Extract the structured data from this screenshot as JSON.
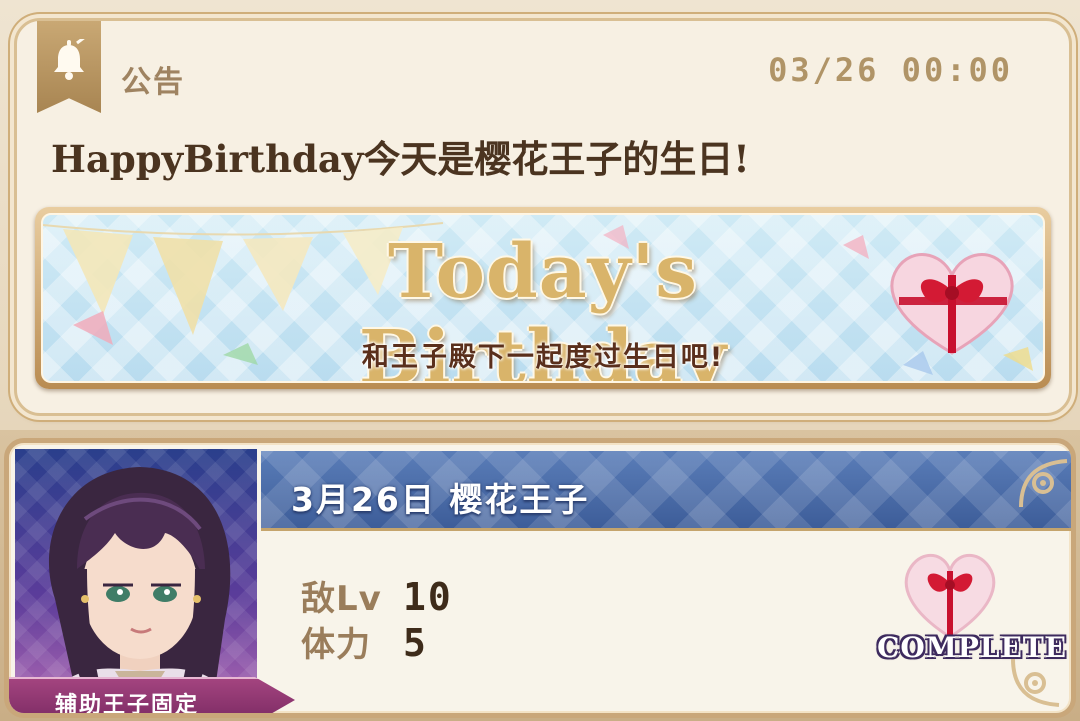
{
  "announcement": {
    "category": "公告",
    "datetime": "03/26 00:00",
    "title": "HappyBirthday今天是樱花王子的生日!",
    "banner": {
      "title": "Today's Birthday",
      "subtitle": "和王子殿下一起度过生日吧!"
    }
  },
  "stage": {
    "title": "3月26日 樱花王子",
    "stats": [
      {
        "label": "敌Lv",
        "value": "10"
      },
      {
        "label": "体力",
        "value": "5"
      }
    ],
    "status": "COMPLETE",
    "support_tag": "辅助王子固定"
  },
  "icons": {
    "bell": "bell-icon",
    "heart_gift": "heart-gift-icon",
    "corner": "ornate-corner-icon"
  },
  "colors": {
    "accent_gold": "#b09467",
    "header_blue": "#3d5d99",
    "tag_magenta": "#7b2a63",
    "banner_sky": "#cfeaf5"
  }
}
